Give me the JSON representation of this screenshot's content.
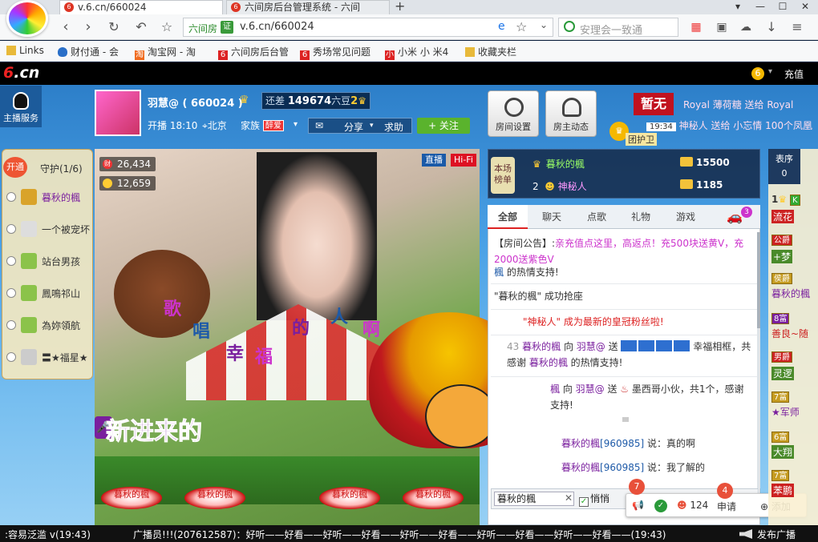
{
  "browser": {
    "tabs": [
      {
        "label": "v.6.cn/660024",
        "icon": "six-icon"
      },
      {
        "label": "六间房后台管理系统 - 六间",
        "icon": "six-icon"
      }
    ],
    "new_tab": "+",
    "url": "v.6.cn/660024",
    "url_site": "六间房",
    "url_badge": "证",
    "search_placeholder": "安理会一致通"
  },
  "bookmarks": [
    {
      "label": "Links",
      "icon": "folder-icon",
      "color": "#e8b93a"
    },
    {
      "label": "财付通 - 会",
      "icon": "shield-icon",
      "color": "#2a6fc8"
    },
    {
      "label": "淘宝网 - 淘",
      "icon": "taobao-icon",
      "color": "#f06b1e"
    },
    {
      "label": "六间房后台管",
      "icon": "six-icon",
      "color": "#d22"
    },
    {
      "label": "秀场常见问题",
      "icon": "six-icon",
      "color": "#d22"
    },
    {
      "label": "小米 小 米4",
      "icon": "mi-icon",
      "color": "#d22"
    },
    {
      "label": "收藏夹栏",
      "icon": "folder-icon",
      "color": "#e8b93a"
    }
  ],
  "site": {
    "logo_num": "6",
    "logo_text": ".cn",
    "coin": "6",
    "recharge": "充值",
    "anchor_service": "主播服务"
  },
  "host": {
    "name": "羽慧@ ( 660024 )",
    "gap_label": "还差",
    "gap_value": "149674",
    "gap_unit": "六豆",
    "gap_level": "2",
    "airtime": "开播 18:10",
    "city": "北京",
    "family": "家族",
    "family_tag": "醉爱",
    "share": "分享",
    "beg": "求助",
    "follow": "+ 关注"
  },
  "room_buttons": [
    {
      "label": "房间设置",
      "icon": "gear-icon"
    },
    {
      "label": "房主动态",
      "icon": "user-icon"
    }
  ],
  "ticker": {
    "zanwu": "暂无",
    "top": "Royal 薄荷糖 送给 Royal",
    "time": "19:34",
    "bottom": "神秘人 送给 小忘情 100个凤凰",
    "guard": "团护卫"
  },
  "guard": {
    "open": "开通",
    "title": "守护(1/6)",
    "items": [
      "暮秋的楓",
      "一个被宠坏",
      "站台男孩",
      "鳳鳴祁山",
      "為妳領航",
      "〓★福星★"
    ]
  },
  "video": {
    "wealth": "26,434",
    "fans": "12,659",
    "live": "直播",
    "hifi": "Hi-Fi",
    "song": [
      "歌",
      "唱",
      "幸",
      "福",
      "的",
      "人",
      "啊"
    ],
    "newcomer": "新进来的",
    "roses": [
      "暮秋的楓",
      "暮秋的楓",
      "暮秋的楓",
      "暮秋的楓"
    ]
  },
  "rank": {
    "badge": "本场榜单",
    "rows": [
      {
        "rank": "1",
        "name": "暮秋的楓",
        "value": "15500"
      },
      {
        "rank": "2",
        "name": "神秘人",
        "value": "1185"
      }
    ]
  },
  "chat": {
    "tabs": [
      "全部",
      "聊天",
      "点歌",
      "礼物",
      "游戏"
    ],
    "car_badge": "3",
    "messages": {
      "announce_prefix": "【房间公告】:",
      "announce_body": "亲充值点这里，高返点！充500块送黄V，充2000送紫色V",
      "announce2_user": "楓",
      "announce2_tail": " 的热情支持!",
      "seat_user": "\"暮秋的楓\"",
      "seat_tail": " 成功抢座",
      "crown": "\"神秘人\" 成为最新的皇冠粉丝啦!",
      "gift1_time": "43",
      "gift1_user": "暮秋的楓",
      "gift1_mid": " 向 ",
      "gift1_host": "羽慧@",
      "gift1_send": " 送 ",
      "gift1_tail": " 幸福相框，共",
      "gift1_thanks": "感谢 ",
      "gift1_thanks_user": "暮秋的楓",
      "gift1_thanks_tail": " 的热情支持!",
      "gift2_user": "楓",
      "gift2_tail": " 墨西哥小伙，共1个，感谢",
      "gift2_tail2": "支持!",
      "say1_user": "暮秋的楓",
      "say1_id": "[960985]",
      "say1_text": " 说：真的啊",
      "say2_user": "暮秋的楓",
      "say2_id": "[960985]",
      "say2_text": " 说：我了解的"
    },
    "target": "暮秋的楓",
    "quiet": "悄悄"
  },
  "rightlist": {
    "sort": "表序",
    "sort_count": "0",
    "items": [
      {
        "label": "1",
        "name": "流花",
        "tag": "K"
      },
      {
        "label": "公爵",
        "name": "+梦"
      },
      {
        "label": "侯爵",
        "name": "暮秋的楓"
      },
      {
        "label": "8富",
        "name": "善良~随"
      },
      {
        "label": "男爵",
        "name": "灵逻"
      },
      {
        "label": "7富",
        "name": "★军师"
      },
      {
        "label": "6富",
        "name": "大翔"
      },
      {
        "label": "7富",
        "name": "苯鹏"
      }
    ]
  },
  "floatbar": {
    "notif": "7",
    "count": "124",
    "apply": "申请",
    "apply_badge": "4",
    "add": "添加"
  },
  "broadcast": {
    "left": ":容易泛滥 v(19:43)",
    "mid": "广播员!!!(207612587)：好听——好看——好听——好看——好听——好看——好听——好看——好听——好看——(19:43)",
    "right": "发布广播"
  }
}
